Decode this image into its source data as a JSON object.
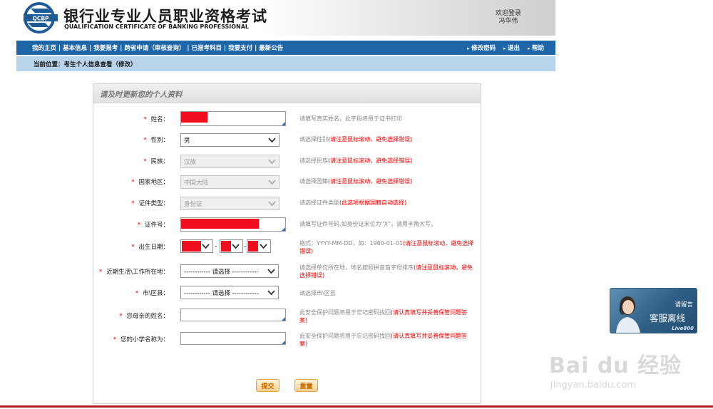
{
  "header": {
    "title_cn": "银行业专业人员职业资格考试",
    "title_en": "QUALIFICATION CERTIFICATE OF BANKING PROFESSIONAL",
    "logo_text": "QCBP",
    "welcome_label": "欢迎登录",
    "user_name": "冯华伟"
  },
  "nav": {
    "items": [
      "我的主页",
      "基本信息",
      "我要报考",
      "跨省申请（审核查询）",
      "已报考科目",
      "我要支付",
      "最新公告"
    ],
    "right_items": [
      "修改密码",
      "退出",
      "帮助"
    ]
  },
  "breadcrumb": "当前位置：考生个人信息查看（修改）",
  "panel": {
    "title": "请及时更新您的个人资料"
  },
  "form": {
    "name": {
      "label": "姓名：",
      "required": true,
      "hint": "请填写真实姓名，此字段将用于证书打印"
    },
    "gender": {
      "label": "性别：",
      "required": true,
      "value": "男",
      "hint": "请选择性别",
      "hint_warn": "(请注意鼠标滚动，避免选择错误)"
    },
    "ethnicity": {
      "label": "民族：",
      "required": true,
      "value": "汉族",
      "hint": "请选择民族",
      "hint_warn": "(请注意鼠标滚动，避免选择错误)"
    },
    "region": {
      "label": "国家地区：",
      "required": true,
      "value": "中国大陆",
      "hint": "请选择国籍",
      "hint_warn": "(请注意鼠标滚动，避免选择错误)"
    },
    "id_type": {
      "label": "证件类型：",
      "required": true,
      "value": "身份证",
      "hint": "请选择证件类型",
      "hint_warn": "(此选项根据国籍自动选择)"
    },
    "id_number": {
      "label": "证件号：",
      "required": true,
      "hint": "请填写证件号码,如身份证末位为“X”，请用半角大写。"
    },
    "birth_date": {
      "label": "出生日期：",
      "required": true,
      "separator": "-",
      "hint": "格式：YYYY-MM-DD，如：1980-01-01",
      "hint_warn": "(请注意鼠标滚动，避免选择错误)"
    },
    "location": {
      "label": "近期生活\\工作所在地：",
      "required": true,
      "value": "------------ 请选择 ------------",
      "hint": "请选择单位所在地，地名按照拼音首字母排序",
      "hint_warn": "(请注意鼠标滚动，避免选择错误)"
    },
    "city": {
      "label": "市\\区县：",
      "required": true,
      "value": "------------ 请选择 ------------",
      "hint": "请选择市\\区县"
    },
    "mother_name": {
      "label": "您母亲的姓名：",
      "required": true,
      "hint": "此安全保护问题将用于忘记密码找回",
      "hint_warn": "(请认真填写并妥善保管问题答案)"
    },
    "school_name": {
      "label": "您的小学名称为：",
      "required": true,
      "hint": "此安全保护问题将用于忘记密码找回",
      "hint_warn": "(请认真填写并妥善保管问题答案)"
    }
  },
  "buttons": {
    "submit": "提交",
    "reset": "重置"
  },
  "service_widget": {
    "message": "请留言",
    "status": "客服离线",
    "brand": "Live800"
  },
  "watermark": {
    "main": "Bai du 经验",
    "sub": "jingyan.baidu.com"
  },
  "colors": {
    "nav_blue": "#1f66a8",
    "breadcrumb_bg": "#b9d3ea",
    "required_red": "#ee0000",
    "redaction_red": "#f00e1e",
    "button_orange": "#f7cf8e"
  }
}
